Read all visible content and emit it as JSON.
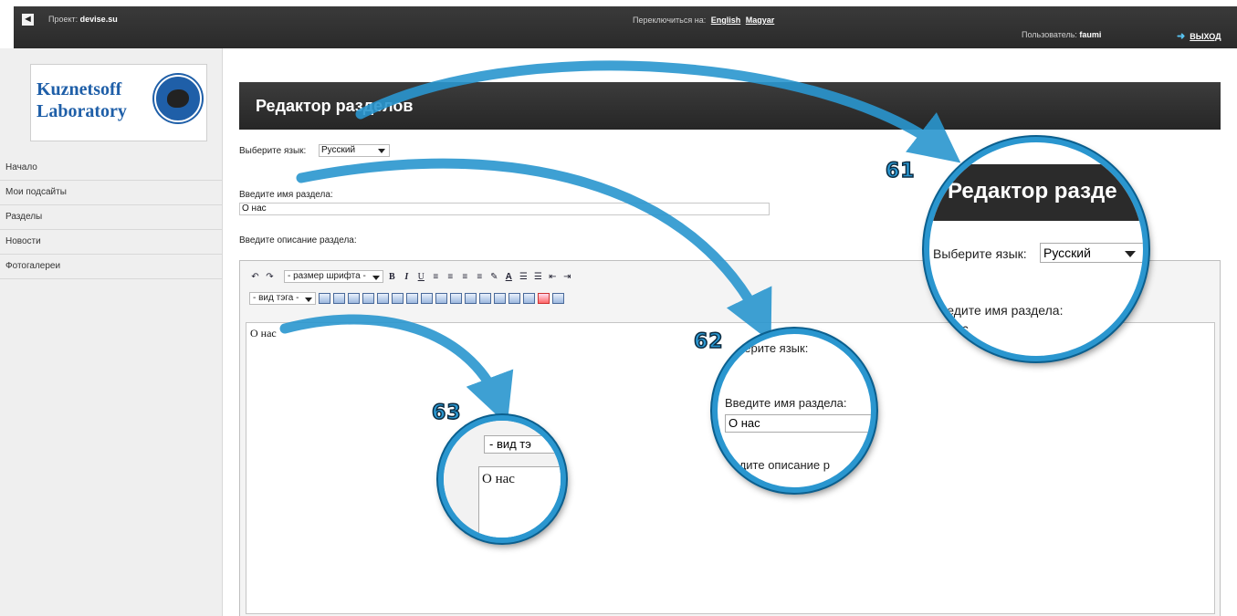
{
  "topbar": {
    "back_icon": "◄",
    "project_label": "Проект:",
    "project_name": "devise.su",
    "switch_label": "Переключиться на:",
    "lang_english": "English",
    "lang_magyar": "Magyar",
    "user_label": "Пользователь:",
    "user_name": "faumi",
    "logout": "ВЫХОД"
  },
  "logo": {
    "line1": "Kuznetsoff",
    "line2": "Laboratory"
  },
  "sidebar": {
    "items": [
      {
        "label": "Начало"
      },
      {
        "label": "Мои подсайты"
      },
      {
        "label": "Разделы"
      },
      {
        "label": "Новости"
      },
      {
        "label": "Фотогалереи"
      }
    ]
  },
  "main": {
    "title": "Редактор разделов",
    "language_label": "Выберите язык:",
    "language_value": "Русский",
    "name_label": "Введите имя раздела:",
    "name_value": "О нас",
    "description_label": "Введите описание раздела:"
  },
  "editor": {
    "font_size_select": "- размер шрифта -",
    "tag_select": "- вид тэга -",
    "content": "О нас",
    "buttons_row1": [
      "↶",
      "↷"
    ],
    "format_buttons": [
      "B",
      "I",
      "U"
    ]
  },
  "callouts": [
    {
      "number": "61",
      "title": "Редактор разде",
      "lang_label": "Выберите язык:",
      "lang_value": "Русский",
      "name_label": "ведите имя раздела:",
      "name_value": "ас"
    },
    {
      "number": "62",
      "lang_label": "берите язык:",
      "name_label": "Введите имя раздела:",
      "name_value": "О нас",
      "desc_label": "ведите описание р"
    },
    {
      "number": "63",
      "tag_select": "- вид тэ",
      "content": "О нас"
    }
  ],
  "colors": {
    "accent": "#2a96cf",
    "dark_bar": "#2b2b2b",
    "logo_blue": "#1f5fa8"
  }
}
